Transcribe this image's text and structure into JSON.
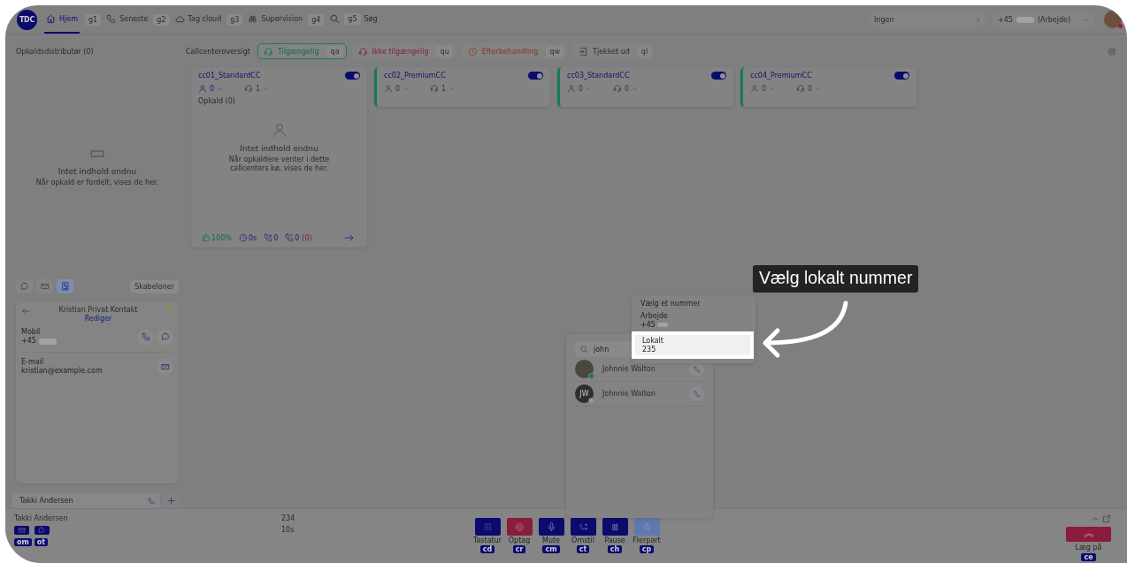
{
  "topbar": {
    "logo": "TDC",
    "nav": [
      {
        "label": "Hjem",
        "shortcut": "g1",
        "kind": "home",
        "selected": true
      },
      {
        "label": "Seneste",
        "shortcut": "g2",
        "kind": "phone",
        "selected": false
      },
      {
        "label": "Tag cloud",
        "shortcut": "g3",
        "kind": "cloud",
        "selected": false
      },
      {
        "label": "Supervision",
        "shortcut": "g4",
        "kind": "binoculars",
        "selected": false
      }
    ],
    "search": {
      "shortcut": "g5",
      "label": "Søg"
    },
    "queue_select": {
      "value": "Ingen"
    },
    "number_select": {
      "prefix": "+45",
      "value": "(Arbejde)"
    }
  },
  "header": {
    "title": "Opkaldsdistributør (0)",
    "overview_label": "Callcenteroversigt",
    "statuses": [
      {
        "label": "Tilgængelig",
        "shortcut": "qa",
        "kind": "available",
        "selected": true
      },
      {
        "label": "Ikke tilgængelig",
        "shortcut": "qu",
        "kind": "unavailable",
        "selected": false
      },
      {
        "label": "Efterbehandling",
        "shortcut": "qw",
        "kind": "wrapup",
        "selected": false
      },
      {
        "label": "Tjekket ud",
        "shortcut": "ql",
        "kind": "checkedout",
        "selected": false
      }
    ]
  },
  "distributor": {
    "empty_title": "Intet indhold endnu",
    "empty_text": "Når opkald er fordelt, vises de her."
  },
  "callcenters": [
    {
      "name": "cc01_StandardCC",
      "on": true,
      "marked": false,
      "expanded": true,
      "agents": "0",
      "headsets": "1",
      "calls_label": "Opkald (0)",
      "empty_title": "Intet indhold endnu",
      "empty_text": "Når opkaldere venter i dette callcenters kø, vises de her.",
      "stats": {
        "rate": "100%",
        "wait": "0s",
        "answered": "0",
        "missed": "0",
        "missed_extra": "(0)"
      }
    },
    {
      "name": "cc02_PremiumCC",
      "on": true,
      "marked": true,
      "expanded": false,
      "agents": "0",
      "headsets": "1"
    },
    {
      "name": "cc03_StandardCC",
      "on": true,
      "marked": true,
      "expanded": false,
      "agents": "0",
      "headsets": "0"
    },
    {
      "name": "cc04_PremiumCC",
      "on": true,
      "marked": true,
      "expanded": false,
      "agents": "0",
      "headsets": "0"
    }
  ],
  "templates": {
    "tools": [
      {
        "kind": "chat",
        "selected": false
      },
      {
        "kind": "mail",
        "selected": false
      },
      {
        "kind": "contact",
        "selected": true
      }
    ],
    "label": "Skabeloner"
  },
  "contact": {
    "name": "Kristian Privat Kontakt",
    "favorite": true,
    "edit_link": "Rediger",
    "fields": [
      {
        "label": "Mobil",
        "value": "+45",
        "kind": "phone"
      },
      {
        "label": "E-mail",
        "value": "kristian@example.com",
        "kind": "email"
      }
    ]
  },
  "tabs": [
    {
      "label": "Takki Andersen",
      "selected": true
    }
  ],
  "call_bar": {
    "caller": "Takki Andersen",
    "actions": [
      {
        "kind": "mail",
        "shortcut": "om"
      },
      {
        "kind": "chat",
        "shortcut": "ot"
      }
    ],
    "number": "234",
    "duration": "10s",
    "controls": [
      {
        "label": "Tastatur",
        "shortcut": "cd",
        "kind": "keypad"
      },
      {
        "label": "Optag",
        "shortcut": "cr",
        "kind": "record"
      },
      {
        "label": "Mute",
        "shortcut": "cm",
        "kind": "mic"
      },
      {
        "label": "Omstil",
        "shortcut": "ct",
        "kind": "transfer"
      },
      {
        "label": "Pause",
        "shortcut": "ch",
        "kind": "pause"
      },
      {
        "label": "Flerpart",
        "shortcut": "cp",
        "kind": "conference"
      }
    ],
    "hangup": {
      "label": "Læg på",
      "shortcut": "ce"
    }
  },
  "search_popup": {
    "query": "john",
    "results": [
      {
        "name": "Johnnie Walton",
        "kind": "photo",
        "color": "#137a60"
      },
      {
        "name": "Johnnie Walton",
        "kind": "initials",
        "initials": "JW",
        "color": "#9a9a9a"
      }
    ]
  },
  "number_menu": {
    "title": "Vælg et nummer",
    "options": [
      {
        "label": "Arbejde",
        "value": "+45",
        "selected": false
      },
      {
        "label": "Lokalt",
        "value": "235",
        "selected": true
      }
    ]
  },
  "callout": {
    "text": "Vælg lokalt nummer"
  }
}
